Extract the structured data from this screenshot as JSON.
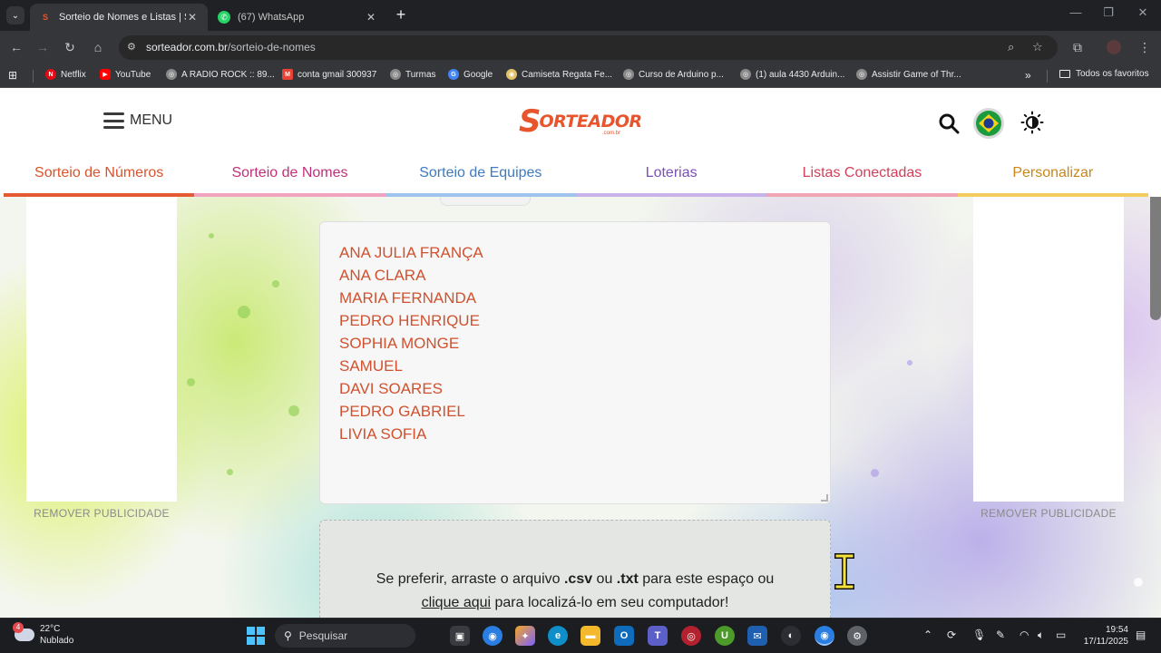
{
  "browser": {
    "tabs": [
      {
        "title": "Sorteio de Nomes e Listas | Sor",
        "active": true
      },
      {
        "title": "(67) WhatsApp",
        "active": false
      }
    ],
    "url_domain": "sorteador.com.br",
    "url_path": "/sorteio-de-nomes",
    "bookmarks": [
      {
        "label": "Netflix",
        "color": "#e50914",
        "glyph": "N"
      },
      {
        "label": "YouTube",
        "color": "#ff0000",
        "glyph": "▶"
      },
      {
        "label": "A RADIO ROCK :: 89...",
        "color": "#8a8a8a",
        "glyph": "◎"
      },
      {
        "label": "conta gmail 300937",
        "color": "#ea4335",
        "glyph": "M"
      },
      {
        "label": "Turmas",
        "color": "#8a8a8a",
        "glyph": "◎"
      },
      {
        "label": "Google",
        "color": "#4285f4",
        "glyph": "G"
      },
      {
        "label": "Camiseta Regata Fe...",
        "color": "#e0c36a",
        "glyph": "◉"
      },
      {
        "label": "Curso de Arduino p...",
        "color": "#8a8a8a",
        "glyph": "◎"
      },
      {
        "label": "(1) aula 4430 Arduin...",
        "color": "#8a8a8a",
        "glyph": "◎"
      },
      {
        "label": "Assistir Game of Thr...",
        "color": "#8a8a8a",
        "glyph": "◎"
      }
    ],
    "all_bookmarks": "Todos os favoritos"
  },
  "site": {
    "menu_label": "MENU",
    "logo_text": "ORTEADOR",
    "logo_initial": "S",
    "logo_domain": ".com.br",
    "brand_color": "#e8542b",
    "nav": [
      {
        "label": "Sorteio de Números",
        "color": "#d9532c",
        "bar": "#e45b33"
      },
      {
        "label": "Sorteio de Nomes",
        "color": "#c0307a",
        "bar": "#f2a3c0"
      },
      {
        "label": "Sorteio de Equipes",
        "color": "#3e7bbf",
        "bar": "#9ec4ee"
      },
      {
        "label": "Loterias",
        "color": "#7b4fb5",
        "bar": "#c7b3ea"
      },
      {
        "label": "Listas Conectadas",
        "color": "#d0405a",
        "bar": "#f1a4b3"
      },
      {
        "label": "Personalizar",
        "color": "#c9861a",
        "bar": "#f3cc5b"
      }
    ],
    "remove_ad_left": "REMOVER PUBLICIDADE",
    "remove_ad_right": "REMOVER PUBLICIDADE",
    "names": [
      "ANA JULIA FRANÇA",
      "ANA CLARA",
      "MARIA FERNANDA",
      "PEDRO HENRIQUE",
      "SOPHIA MONGE",
      "SAMUEL",
      "DAVI SOARES",
      "PEDRO GABRIEL",
      "LIVIA SOFIA"
    ],
    "drop": {
      "line1_a": "Se preferir, arraste o arquivo ",
      "csv": ".csv",
      "line1_b": " ou ",
      "txt": ".txt",
      "line1_c": " para este espaço ou",
      "link": "clique aqui",
      "line2": " para localizá-lo em seu computador!"
    }
  },
  "taskbar": {
    "weather_temp": "22°C",
    "weather_desc": "Nublado",
    "weather_badge": "4",
    "search_placeholder": "Pesquisar",
    "time": "19:54",
    "date": "17/11/2025"
  }
}
